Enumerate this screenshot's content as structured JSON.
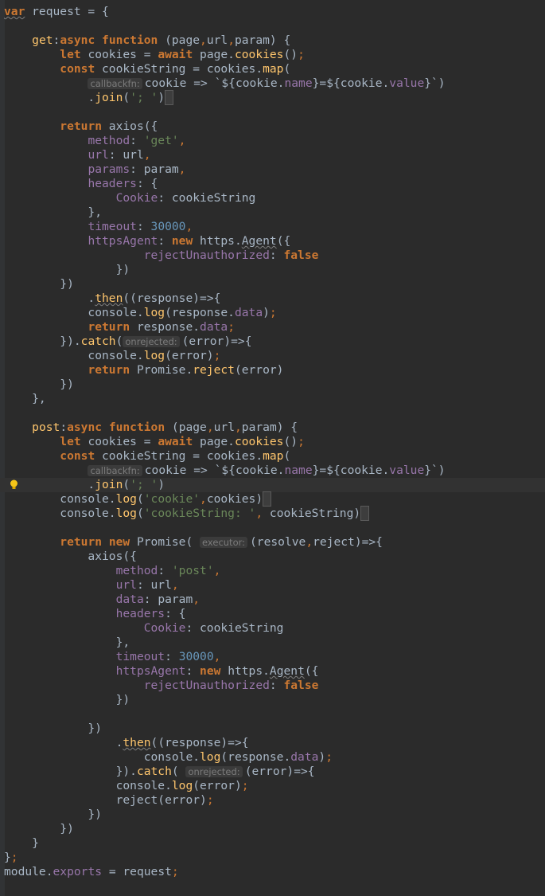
{
  "editor": {
    "language": "javascript",
    "current_line": 33,
    "lines": [
      [
        {
          "t": "var",
          "c": "kw wavy"
        },
        {
          "t": " request = {",
          "c": "plain"
        }
      ],
      [],
      [
        {
          "t": "    ",
          "c": "plain"
        },
        {
          "t": "get",
          "c": "fn"
        },
        {
          "t": ":",
          "c": "plain"
        },
        {
          "t": "async function",
          "c": "kw"
        },
        {
          "t": " (page",
          "c": "plain"
        },
        {
          "t": ",",
          "c": "punct"
        },
        {
          "t": "url",
          "c": "plain"
        },
        {
          "t": ",",
          "c": "punct"
        },
        {
          "t": "param) {",
          "c": "plain"
        }
      ],
      [
        {
          "t": "        ",
          "c": "plain"
        },
        {
          "t": "let",
          "c": "kw"
        },
        {
          "t": " cookies = ",
          "c": "plain"
        },
        {
          "t": "await",
          "c": "kw"
        },
        {
          "t": " page.",
          "c": "plain"
        },
        {
          "t": "cookies",
          "c": "fn"
        },
        {
          "t": "()",
          "c": "plain"
        },
        {
          "t": ";",
          "c": "punct"
        }
      ],
      [
        {
          "t": "        ",
          "c": "plain"
        },
        {
          "t": "const",
          "c": "kw"
        },
        {
          "t": " cookieString = cookies.",
          "c": "plain"
        },
        {
          "t": "map",
          "c": "fn"
        },
        {
          "t": "(",
          "c": "plain"
        }
      ],
      [
        {
          "t": "            ",
          "c": "plain"
        },
        {
          "t": "callbackfn:",
          "c": "hint"
        },
        {
          "t": "cookie => `${cookie.",
          "c": "plain"
        },
        {
          "t": "name",
          "c": "prop"
        },
        {
          "t": "}=${cookie.",
          "c": "plain"
        },
        {
          "t": "value",
          "c": "prop"
        },
        {
          "t": "}`)",
          "c": "plain"
        }
      ],
      [
        {
          "t": "            .",
          "c": "plain"
        },
        {
          "t": "join",
          "c": "fn"
        },
        {
          "t": "(",
          "c": "plain"
        },
        {
          "t": "'; '",
          "c": "str"
        },
        {
          "t": ")",
          "c": "plain"
        },
        {
          "t": " ",
          "c": "cursor"
        }
      ],
      [],
      [
        {
          "t": "        ",
          "c": "plain"
        },
        {
          "t": "return",
          "c": "kw"
        },
        {
          "t": " axios({",
          "c": "plain"
        }
      ],
      [
        {
          "t": "            ",
          "c": "plain"
        },
        {
          "t": "method",
          "c": "prop"
        },
        {
          "t": ": ",
          "c": "plain"
        },
        {
          "t": "'get'",
          "c": "str"
        },
        {
          "t": ",",
          "c": "punct"
        }
      ],
      [
        {
          "t": "            ",
          "c": "plain"
        },
        {
          "t": "url",
          "c": "prop"
        },
        {
          "t": ": url",
          "c": "plain"
        },
        {
          "t": ",",
          "c": "punct"
        }
      ],
      [
        {
          "t": "            ",
          "c": "plain"
        },
        {
          "t": "params",
          "c": "prop"
        },
        {
          "t": ": param",
          "c": "plain"
        },
        {
          "t": ",",
          "c": "punct"
        }
      ],
      [
        {
          "t": "            ",
          "c": "plain"
        },
        {
          "t": "headers",
          "c": "prop"
        },
        {
          "t": ": {",
          "c": "plain"
        }
      ],
      [
        {
          "t": "                ",
          "c": "plain"
        },
        {
          "t": "Cookie",
          "c": "prop"
        },
        {
          "t": ": cookieString",
          "c": "plain"
        }
      ],
      [
        {
          "t": "            },",
          "c": "plain"
        }
      ],
      [
        {
          "t": "            ",
          "c": "plain"
        },
        {
          "t": "timeout",
          "c": "prop"
        },
        {
          "t": ": ",
          "c": "plain"
        },
        {
          "t": "30000",
          "c": "num"
        },
        {
          "t": ",",
          "c": "punct"
        }
      ],
      [
        {
          "t": "            ",
          "c": "plain"
        },
        {
          "t": "httpsAgent",
          "c": "prop"
        },
        {
          "t": ": ",
          "c": "plain"
        },
        {
          "t": "new",
          "c": "kw"
        },
        {
          "t": " https.",
          "c": "plain"
        },
        {
          "t": "Agent",
          "c": "plain wavy"
        },
        {
          "t": "({",
          "c": "plain"
        }
      ],
      [
        {
          "t": "                    ",
          "c": "plain"
        },
        {
          "t": "rejectUnauthorized",
          "c": "prop"
        },
        {
          "t": ": ",
          "c": "plain"
        },
        {
          "t": "false",
          "c": "kw"
        }
      ],
      [
        {
          "t": "                })",
          "c": "plain"
        }
      ],
      [
        {
          "t": "        })",
          "c": "plain"
        }
      ],
      [
        {
          "t": "            .",
          "c": "plain"
        },
        {
          "t": "then",
          "c": "fn wavy"
        },
        {
          "t": "((response)=>{",
          "c": "plain"
        }
      ],
      [
        {
          "t": "            console.",
          "c": "plain"
        },
        {
          "t": "log",
          "c": "fn"
        },
        {
          "t": "(response.",
          "c": "plain"
        },
        {
          "t": "data",
          "c": "prop"
        },
        {
          "t": ")",
          "c": "plain"
        },
        {
          "t": ";",
          "c": "punct"
        }
      ],
      [
        {
          "t": "            ",
          "c": "plain"
        },
        {
          "t": "return",
          "c": "kw"
        },
        {
          "t": " response.",
          "c": "plain"
        },
        {
          "t": "data",
          "c": "prop"
        },
        {
          "t": ";",
          "c": "punct"
        }
      ],
      [
        {
          "t": "        }).",
          "c": "plain"
        },
        {
          "t": "catch",
          "c": "fn"
        },
        {
          "t": "(",
          "c": "plain"
        },
        {
          "t": "onrejected:",
          "c": "hint"
        },
        {
          "t": "(error)=>{",
          "c": "plain"
        }
      ],
      [
        {
          "t": "            console.",
          "c": "plain"
        },
        {
          "t": "log",
          "c": "fn"
        },
        {
          "t": "(error)",
          "c": "plain"
        },
        {
          "t": ";",
          "c": "punct"
        }
      ],
      [
        {
          "t": "            ",
          "c": "plain"
        },
        {
          "t": "return",
          "c": "kw"
        },
        {
          "t": " Promise.",
          "c": "plain"
        },
        {
          "t": "reject",
          "c": "fn"
        },
        {
          "t": "(error)",
          "c": "plain"
        }
      ],
      [
        {
          "t": "        })",
          "c": "plain"
        }
      ],
      [
        {
          "t": "    },",
          "c": "plain"
        }
      ],
      [],
      [
        {
          "t": "    ",
          "c": "plain"
        },
        {
          "t": "post",
          "c": "fn"
        },
        {
          "t": ":",
          "c": "plain"
        },
        {
          "t": "async function",
          "c": "kw"
        },
        {
          "t": " (page",
          "c": "plain"
        },
        {
          "t": ",",
          "c": "punct"
        },
        {
          "t": "url",
          "c": "plain"
        },
        {
          "t": ",",
          "c": "punct"
        },
        {
          "t": "param) {",
          "c": "plain"
        }
      ],
      [
        {
          "t": "        ",
          "c": "plain"
        },
        {
          "t": "let",
          "c": "kw"
        },
        {
          "t": " cookies = ",
          "c": "plain"
        },
        {
          "t": "await",
          "c": "kw"
        },
        {
          "t": " page.",
          "c": "plain"
        },
        {
          "t": "cookies",
          "c": "fn"
        },
        {
          "t": "()",
          "c": "plain"
        },
        {
          "t": ";",
          "c": "punct"
        }
      ],
      [
        {
          "t": "        ",
          "c": "plain"
        },
        {
          "t": "const",
          "c": "kw"
        },
        {
          "t": " cookieString = cookies.",
          "c": "plain"
        },
        {
          "t": "map",
          "c": "fn"
        },
        {
          "t": "(",
          "c": "plain"
        }
      ],
      [
        {
          "t": "            ",
          "c": "plain"
        },
        {
          "t": "callbackfn:",
          "c": "hint"
        },
        {
          "t": "cookie => `${cookie.",
          "c": "plain"
        },
        {
          "t": "name",
          "c": "prop"
        },
        {
          "t": "}=${cookie.",
          "c": "plain"
        },
        {
          "t": "value",
          "c": "prop"
        },
        {
          "t": "}`)",
          "c": "plain"
        }
      ],
      [
        {
          "t": "            .",
          "c": "plain"
        },
        {
          "t": "join",
          "c": "fn"
        },
        {
          "t": "(",
          "c": "plain"
        },
        {
          "t": "'; '",
          "c": "str"
        },
        {
          "t": ")",
          "c": "plain"
        }
      ],
      [
        {
          "t": "        console.",
          "c": "plain"
        },
        {
          "t": "log",
          "c": "fn"
        },
        {
          "t": "(",
          "c": "plain"
        },
        {
          "t": "'cookie'",
          "c": "str"
        },
        {
          "t": ",",
          "c": "punct"
        },
        {
          "t": "cookies)",
          "c": "plain"
        },
        {
          "t": " ",
          "c": "cursor"
        }
      ],
      [
        {
          "t": "        console.",
          "c": "plain"
        },
        {
          "t": "log",
          "c": "fn"
        },
        {
          "t": "(",
          "c": "plain"
        },
        {
          "t": "'cookieString: '",
          "c": "str"
        },
        {
          "t": ", ",
          "c": "punct"
        },
        {
          "t": "cookieString)",
          "c": "plain"
        },
        {
          "t": " ",
          "c": "cursor"
        }
      ],
      [],
      [
        {
          "t": "        ",
          "c": "plain"
        },
        {
          "t": "return",
          "c": "kw"
        },
        {
          "t": " ",
          "c": "plain"
        },
        {
          "t": "new",
          "c": "kw"
        },
        {
          "t": " Promise( ",
          "c": "plain"
        },
        {
          "t": "executor:",
          "c": "hint"
        },
        {
          "t": "(resolve",
          "c": "plain"
        },
        {
          "t": ",",
          "c": "punct"
        },
        {
          "t": "reject)=>{",
          "c": "plain"
        }
      ],
      [
        {
          "t": "            axios({",
          "c": "plain"
        }
      ],
      [
        {
          "t": "                ",
          "c": "plain"
        },
        {
          "t": "method",
          "c": "prop"
        },
        {
          "t": ": ",
          "c": "plain"
        },
        {
          "t": "'post'",
          "c": "str"
        },
        {
          "t": ",",
          "c": "punct"
        }
      ],
      [
        {
          "t": "                ",
          "c": "plain"
        },
        {
          "t": "url",
          "c": "prop"
        },
        {
          "t": ": url",
          "c": "plain"
        },
        {
          "t": ",",
          "c": "punct"
        }
      ],
      [
        {
          "t": "                ",
          "c": "plain"
        },
        {
          "t": "data",
          "c": "prop"
        },
        {
          "t": ": param",
          "c": "plain"
        },
        {
          "t": ",",
          "c": "punct"
        }
      ],
      [
        {
          "t": "                ",
          "c": "plain"
        },
        {
          "t": "headers",
          "c": "prop"
        },
        {
          "t": ": {",
          "c": "plain"
        }
      ],
      [
        {
          "t": "                    ",
          "c": "plain"
        },
        {
          "t": "Cookie",
          "c": "prop"
        },
        {
          "t": ": cookieString",
          "c": "plain"
        }
      ],
      [
        {
          "t": "                },",
          "c": "plain"
        }
      ],
      [
        {
          "t": "                ",
          "c": "plain"
        },
        {
          "t": "timeout",
          "c": "prop"
        },
        {
          "t": ": ",
          "c": "plain"
        },
        {
          "t": "30000",
          "c": "num"
        },
        {
          "t": ",",
          "c": "punct"
        }
      ],
      [
        {
          "t": "                ",
          "c": "plain"
        },
        {
          "t": "httpsAgent",
          "c": "prop"
        },
        {
          "t": ": ",
          "c": "plain"
        },
        {
          "t": "new",
          "c": "kw"
        },
        {
          "t": " https.",
          "c": "plain"
        },
        {
          "t": "Agent",
          "c": "plain wavy"
        },
        {
          "t": "({",
          "c": "plain"
        }
      ],
      [
        {
          "t": "                    ",
          "c": "plain"
        },
        {
          "t": "rejectUnauthorized",
          "c": "prop"
        },
        {
          "t": ": ",
          "c": "plain"
        },
        {
          "t": "false",
          "c": "kw"
        }
      ],
      [
        {
          "t": "                })",
          "c": "plain"
        }
      ],
      [],
      [
        {
          "t": "            })",
          "c": "plain"
        }
      ],
      [
        {
          "t": "                .",
          "c": "plain"
        },
        {
          "t": "then",
          "c": "fn wavy"
        },
        {
          "t": "((response)=>{",
          "c": "plain"
        }
      ],
      [
        {
          "t": "                    console.",
          "c": "plain"
        },
        {
          "t": "log",
          "c": "fn"
        },
        {
          "t": "(response.",
          "c": "plain"
        },
        {
          "t": "data",
          "c": "prop"
        },
        {
          "t": ")",
          "c": "plain"
        },
        {
          "t": ";",
          "c": "punct"
        }
      ],
      [
        {
          "t": "                }).",
          "c": "plain"
        },
        {
          "t": "catch",
          "c": "fn"
        },
        {
          "t": "( ",
          "c": "plain"
        },
        {
          "t": "onrejected:",
          "c": "hint"
        },
        {
          "t": "(error)=>{",
          "c": "plain"
        }
      ],
      [
        {
          "t": "                console.",
          "c": "plain"
        },
        {
          "t": "log",
          "c": "fn"
        },
        {
          "t": "(error)",
          "c": "plain"
        },
        {
          "t": ";",
          "c": "punct"
        }
      ],
      [
        {
          "t": "                reject(error)",
          "c": "plain"
        },
        {
          "t": ";",
          "c": "punct"
        }
      ],
      [
        {
          "t": "            })",
          "c": "plain"
        }
      ],
      [
        {
          "t": "        })",
          "c": "plain"
        }
      ],
      [
        {
          "t": "    }",
          "c": "plain"
        }
      ],
      [
        {
          "t": "}",
          "c": "plain"
        },
        {
          "t": ";",
          "c": "punct"
        }
      ],
      [
        {
          "t": "module",
          "c": "plain"
        },
        {
          "t": ".",
          "c": "plain"
        },
        {
          "t": "exports",
          "c": "prop"
        },
        {
          "t": " = request",
          "c": "plain"
        },
        {
          "t": ";",
          "c": "punct"
        }
      ]
    ]
  }
}
